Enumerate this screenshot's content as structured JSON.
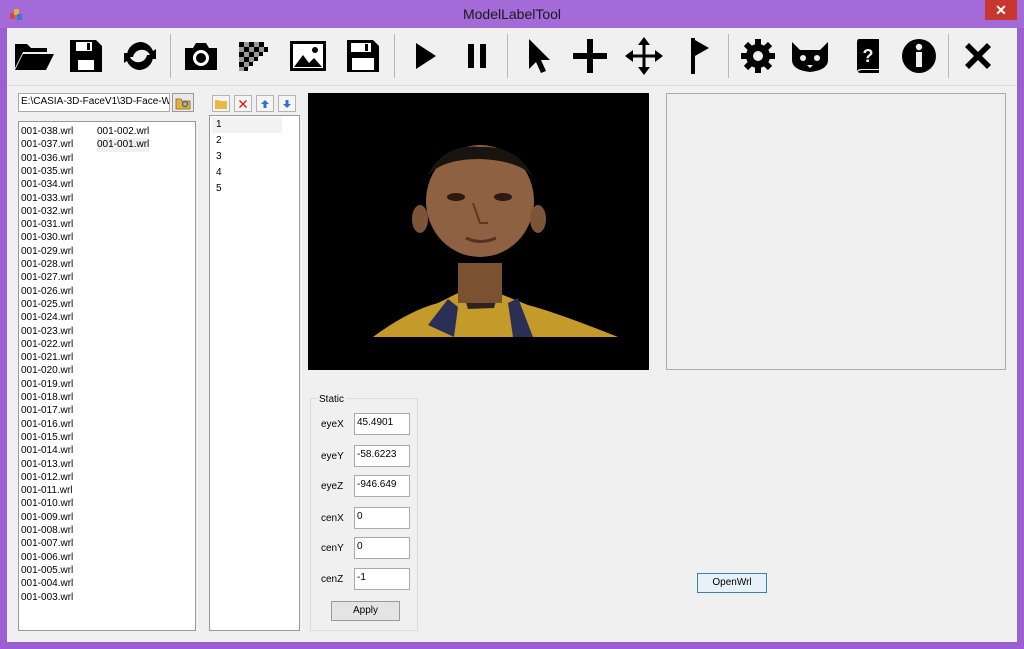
{
  "window": {
    "title": "ModelLabelTool",
    "close_label": "✕"
  },
  "toolbar": {
    "buttons": [
      {
        "name": "open-folder-icon"
      },
      {
        "name": "save-icon"
      },
      {
        "name": "refresh-icon"
      },
      {
        "name": "camera-icon"
      },
      {
        "name": "checkerboard-icon"
      },
      {
        "name": "image-icon"
      },
      {
        "name": "floppy-icon"
      },
      {
        "name": "play-icon"
      },
      {
        "name": "pause-icon"
      },
      {
        "name": "cursor-icon"
      },
      {
        "name": "plus-icon"
      },
      {
        "name": "move-icon"
      },
      {
        "name": "flag-icon"
      },
      {
        "name": "gear-icon"
      },
      {
        "name": "animal-icon"
      },
      {
        "name": "help-book-icon"
      },
      {
        "name": "info-icon"
      },
      {
        "name": "close-icon"
      }
    ]
  },
  "path": {
    "value": "E:\\CASIA-3D-FaceV1\\3D-Face-W"
  },
  "files_col1": [
    "001-038.wrl",
    "001-037.wrl",
    "001-036.wrl",
    "001-035.wrl",
    "001-034.wrl",
    "001-033.wrl",
    "001-032.wrl",
    "001-031.wrl",
    "001-030.wrl",
    "001-029.wrl",
    "001-028.wrl",
    "001-027.wrl",
    "001-026.wrl",
    "001-025.wrl",
    "001-024.wrl",
    "001-023.wrl",
    "001-022.wrl",
    "001-021.wrl",
    "001-020.wrl",
    "001-019.wrl",
    "001-018.wrl",
    "001-017.wrl",
    "001-016.wrl",
    "001-015.wrl",
    "001-014.wrl",
    "001-013.wrl",
    "001-012.wrl",
    "001-011.wrl",
    "001-010.wrl",
    "001-009.wrl",
    "001-008.wrl",
    "001-007.wrl",
    "001-006.wrl",
    "001-005.wrl",
    "001-004.wrl",
    "001-003.wrl"
  ],
  "files_col2": [
    "001-002.wrl",
    "001-001.wrl"
  ],
  "numbers": [
    "1",
    "2",
    "3",
    "4",
    "5"
  ],
  "static": {
    "group_label": "Static",
    "fields": [
      {
        "label": "eyeX",
        "value": "45.4901"
      },
      {
        "label": "eyeY",
        "value": "-58.6223"
      },
      {
        "label": "eyeZ",
        "value": "-946.649"
      },
      {
        "label": "cenX",
        "value": "0"
      },
      {
        "label": "cenY",
        "value": "0"
      },
      {
        "label": "cenZ",
        "value": "-1"
      }
    ],
    "apply_label": "Apply"
  },
  "open_wrl_label": "OpenWrl",
  "colors": {
    "titlebar": "#a36ad8",
    "close": "#c7372f",
    "accent": "#3c7fb1"
  }
}
